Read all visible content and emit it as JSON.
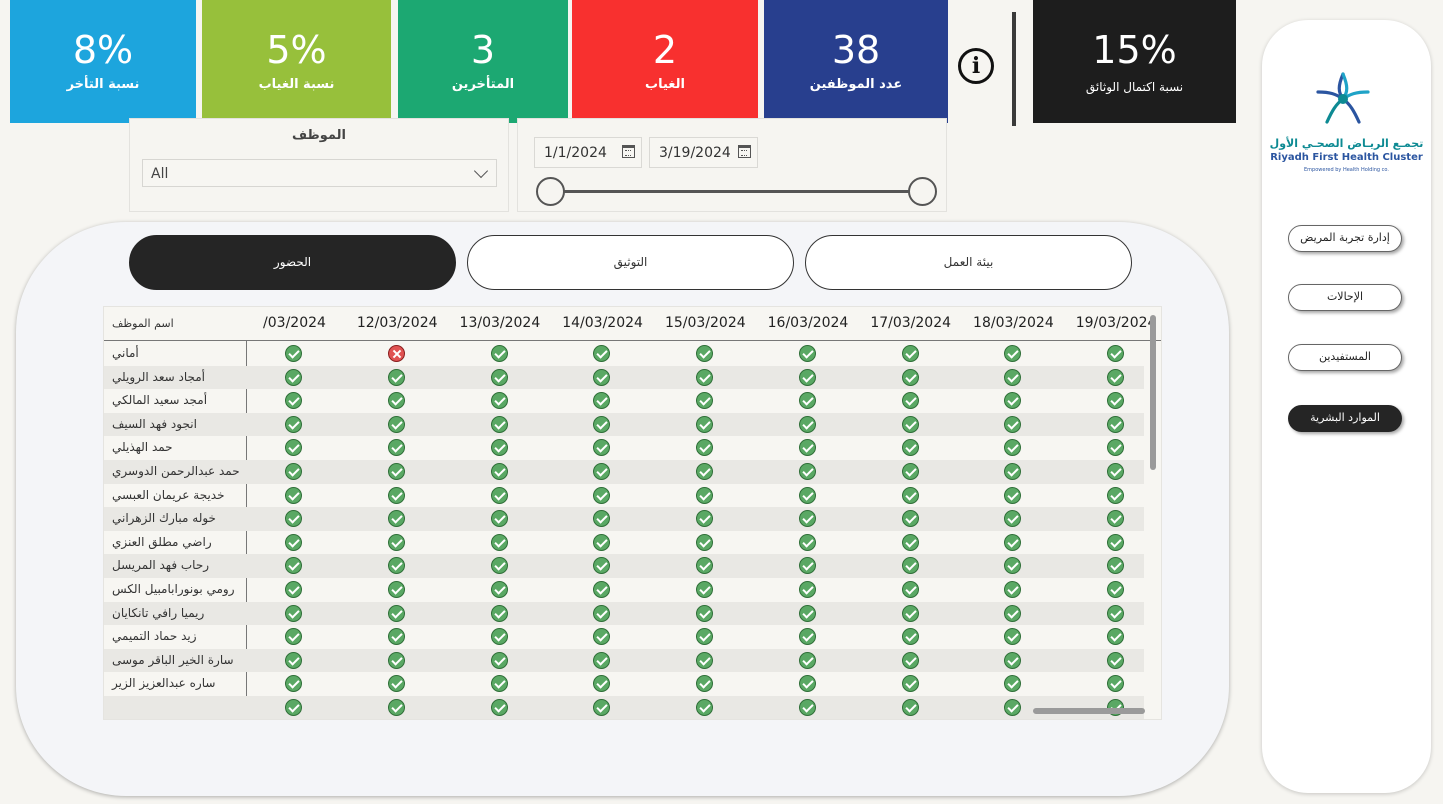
{
  "kpis": {
    "late_rate": {
      "value": "8%",
      "label": "نسبة التأخر",
      "color": "#1da5dd"
    },
    "absence_rate": {
      "value": "5%",
      "label": "نسبة الغياب",
      "color": "#97c03b"
    },
    "late_count": {
      "value": "3",
      "label": "المتأخرين",
      "color": "#1ca872"
    },
    "absence_count": {
      "value": "2",
      "label": "الغياب",
      "color": "#f8302f"
    },
    "employee_count": {
      "value": "38",
      "label": "عدد الموظفين",
      "color": "#283f8e"
    },
    "doc_completion": {
      "value": "15%",
      "label": "نسبة اكتمال الوثائق",
      "color": "#1d1d1d"
    }
  },
  "info_icon": {
    "glyph": "i",
    "icon": "info-icon"
  },
  "filters": {
    "employee_title": "الموظف",
    "employee_value": "All",
    "date_start": "1/1/2024",
    "date_end": "3/19/2024"
  },
  "tabs": {
    "attendance": "الحضور",
    "documentation": "التوثيق",
    "work_env": "بيئة العمل"
  },
  "table": {
    "name_header": "اسم الموظف",
    "date_headers": [
      "/03/2024",
      "12/03/2024",
      "13/03/2024",
      "14/03/2024",
      "15/03/2024",
      "16/03/2024",
      "17/03/2024",
      "18/03/2024",
      "19/03/2024"
    ],
    "rows": [
      {
        "name": "أماني",
        "status": [
          "ok",
          "no",
          "ok",
          "ok",
          "ok",
          "ok",
          "ok",
          "ok",
          "ok"
        ]
      },
      {
        "name": "أمجاد سعد الرويلي",
        "status": [
          "ok",
          "ok",
          "ok",
          "ok",
          "ok",
          "ok",
          "ok",
          "ok",
          "ok"
        ]
      },
      {
        "name": "أمجد سعيد المالكي",
        "status": [
          "ok",
          "ok",
          "ok",
          "ok",
          "ok",
          "ok",
          "ok",
          "ok",
          "ok"
        ]
      },
      {
        "name": "انجود فهد السيف",
        "status": [
          "ok",
          "ok",
          "ok",
          "ok",
          "ok",
          "ok",
          "ok",
          "ok",
          "ok"
        ]
      },
      {
        "name": "حمد الهذيلي",
        "status": [
          "ok",
          "ok",
          "ok",
          "ok",
          "ok",
          "ok",
          "ok",
          "ok",
          "ok"
        ]
      },
      {
        "name": "حمد عبدالرحمن الدوسري",
        "status": [
          "ok",
          "ok",
          "ok",
          "ok",
          "ok",
          "ok",
          "ok",
          "ok",
          "ok"
        ]
      },
      {
        "name": "خديجة عريمان العبسي",
        "status": [
          "ok",
          "ok",
          "ok",
          "ok",
          "ok",
          "ok",
          "ok",
          "ok",
          "ok"
        ]
      },
      {
        "name": "خوله مبارك الزهراني",
        "status": [
          "ok",
          "ok",
          "ok",
          "ok",
          "ok",
          "ok",
          "ok",
          "ok",
          "ok"
        ]
      },
      {
        "name": "راضي مطلق العنزي",
        "status": [
          "ok",
          "ok",
          "ok",
          "ok",
          "ok",
          "ok",
          "ok",
          "ok",
          "ok"
        ]
      },
      {
        "name": "رحاب فهد المريسل",
        "status": [
          "ok",
          "ok",
          "ok",
          "ok",
          "ok",
          "ok",
          "ok",
          "ok",
          "ok"
        ]
      },
      {
        "name": "رومي بونورابامبيل الكس",
        "status": [
          "ok",
          "ok",
          "ok",
          "ok",
          "ok",
          "ok",
          "ok",
          "ok",
          "ok"
        ]
      },
      {
        "name": "ريميا رافي تانكايان",
        "status": [
          "ok",
          "ok",
          "ok",
          "ok",
          "ok",
          "ok",
          "ok",
          "ok",
          "ok"
        ]
      },
      {
        "name": "زيد حماد التميمي",
        "status": [
          "ok",
          "ok",
          "ok",
          "ok",
          "ok",
          "ok",
          "ok",
          "ok",
          "ok"
        ]
      },
      {
        "name": "سارة الخير الباقر موسى",
        "status": [
          "ok",
          "ok",
          "ok",
          "ok",
          "ok",
          "ok",
          "ok",
          "ok",
          "ok"
        ]
      },
      {
        "name": "ساره عبدالعزيز الزير",
        "status": [
          "ok",
          "ok",
          "ok",
          "ok",
          "ok",
          "ok",
          "ok",
          "ok",
          "ok"
        ]
      },
      {
        "name": "",
        "status": [
          "ok",
          "ok",
          "ok",
          "ok",
          "ok",
          "ok",
          "ok",
          "ok",
          "ok"
        ]
      }
    ]
  },
  "brand": {
    "name_ar": "تجمـع الريـاض الصحـي الأول",
    "name_en": "Riyadh First Health Cluster",
    "tagline": "Empowered by Health Holding co.",
    "color_teal": "#0d8a93",
    "color_blue": "#2b55a0"
  },
  "nav": {
    "patient_experience": "إدارة تجربة المريض",
    "referrals": "الإحالات",
    "beneficiaries": "المستفيدين",
    "hr": "الموارد البشرية"
  }
}
